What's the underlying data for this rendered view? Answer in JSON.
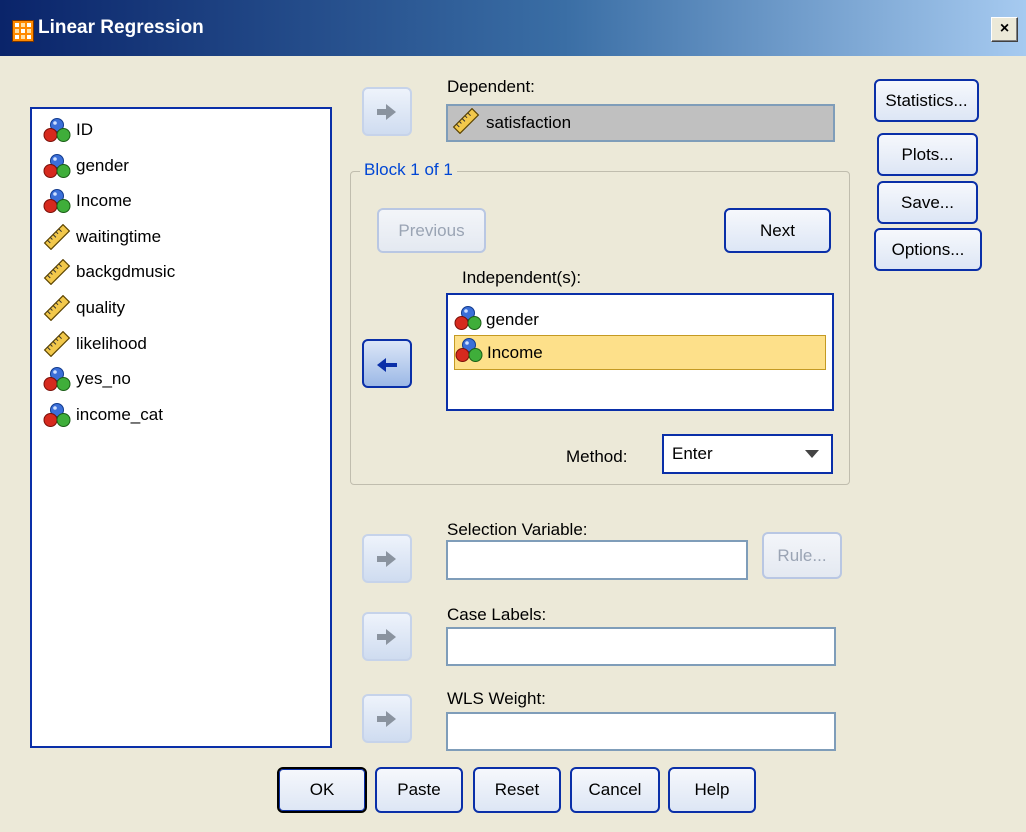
{
  "window": {
    "title": "Linear Regression",
    "close_glyph": "×"
  },
  "variables": [
    {
      "label": "ID",
      "icon": "nominal-icon"
    },
    {
      "label": "gender",
      "icon": "nominal-icon"
    },
    {
      "label": "Income",
      "icon": "nominal-icon"
    },
    {
      "label": "waitingtime",
      "icon": "scale-ruler-icon"
    },
    {
      "label": "backgdmusic",
      "icon": "scale-ruler-icon"
    },
    {
      "label": "quality",
      "icon": "scale-ruler-icon"
    },
    {
      "label": "likelihood",
      "icon": "scale-ruler-icon"
    },
    {
      "label": "yes_no",
      "icon": "nominal-icon"
    },
    {
      "label": "income_cat",
      "icon": "nominal-icon"
    }
  ],
  "dependent": {
    "label": "Dependent:",
    "value": "satisfaction"
  },
  "block": {
    "legend": "Block 1 of 1",
    "previous_label": "Previous",
    "next_label": "Next",
    "independents_label": "Independent(s):",
    "independents": [
      {
        "label": "gender",
        "selected": false
      },
      {
        "label": "Income",
        "selected": true
      }
    ],
    "method_label": "Method:",
    "method_value": "Enter"
  },
  "selection": {
    "label": "Selection Variable:",
    "value": "",
    "rule_label": "Rule..."
  },
  "case_labels": {
    "label": "Case Labels:",
    "value": ""
  },
  "wls_weight": {
    "label": "WLS Weight:",
    "value": ""
  },
  "side_buttons": {
    "statistics": "Statistics...",
    "plots": "Plots...",
    "save": "Save...",
    "options": "Options..."
  },
  "footer_buttons": {
    "ok": "OK",
    "paste": "Paste",
    "reset": "Reset",
    "cancel": "Cancel",
    "help": "Help"
  },
  "colors": {
    "selection_highlight": "#fde08a",
    "accent_blue": "#0a2fa8",
    "dialog_bg": "#ece9d8"
  }
}
